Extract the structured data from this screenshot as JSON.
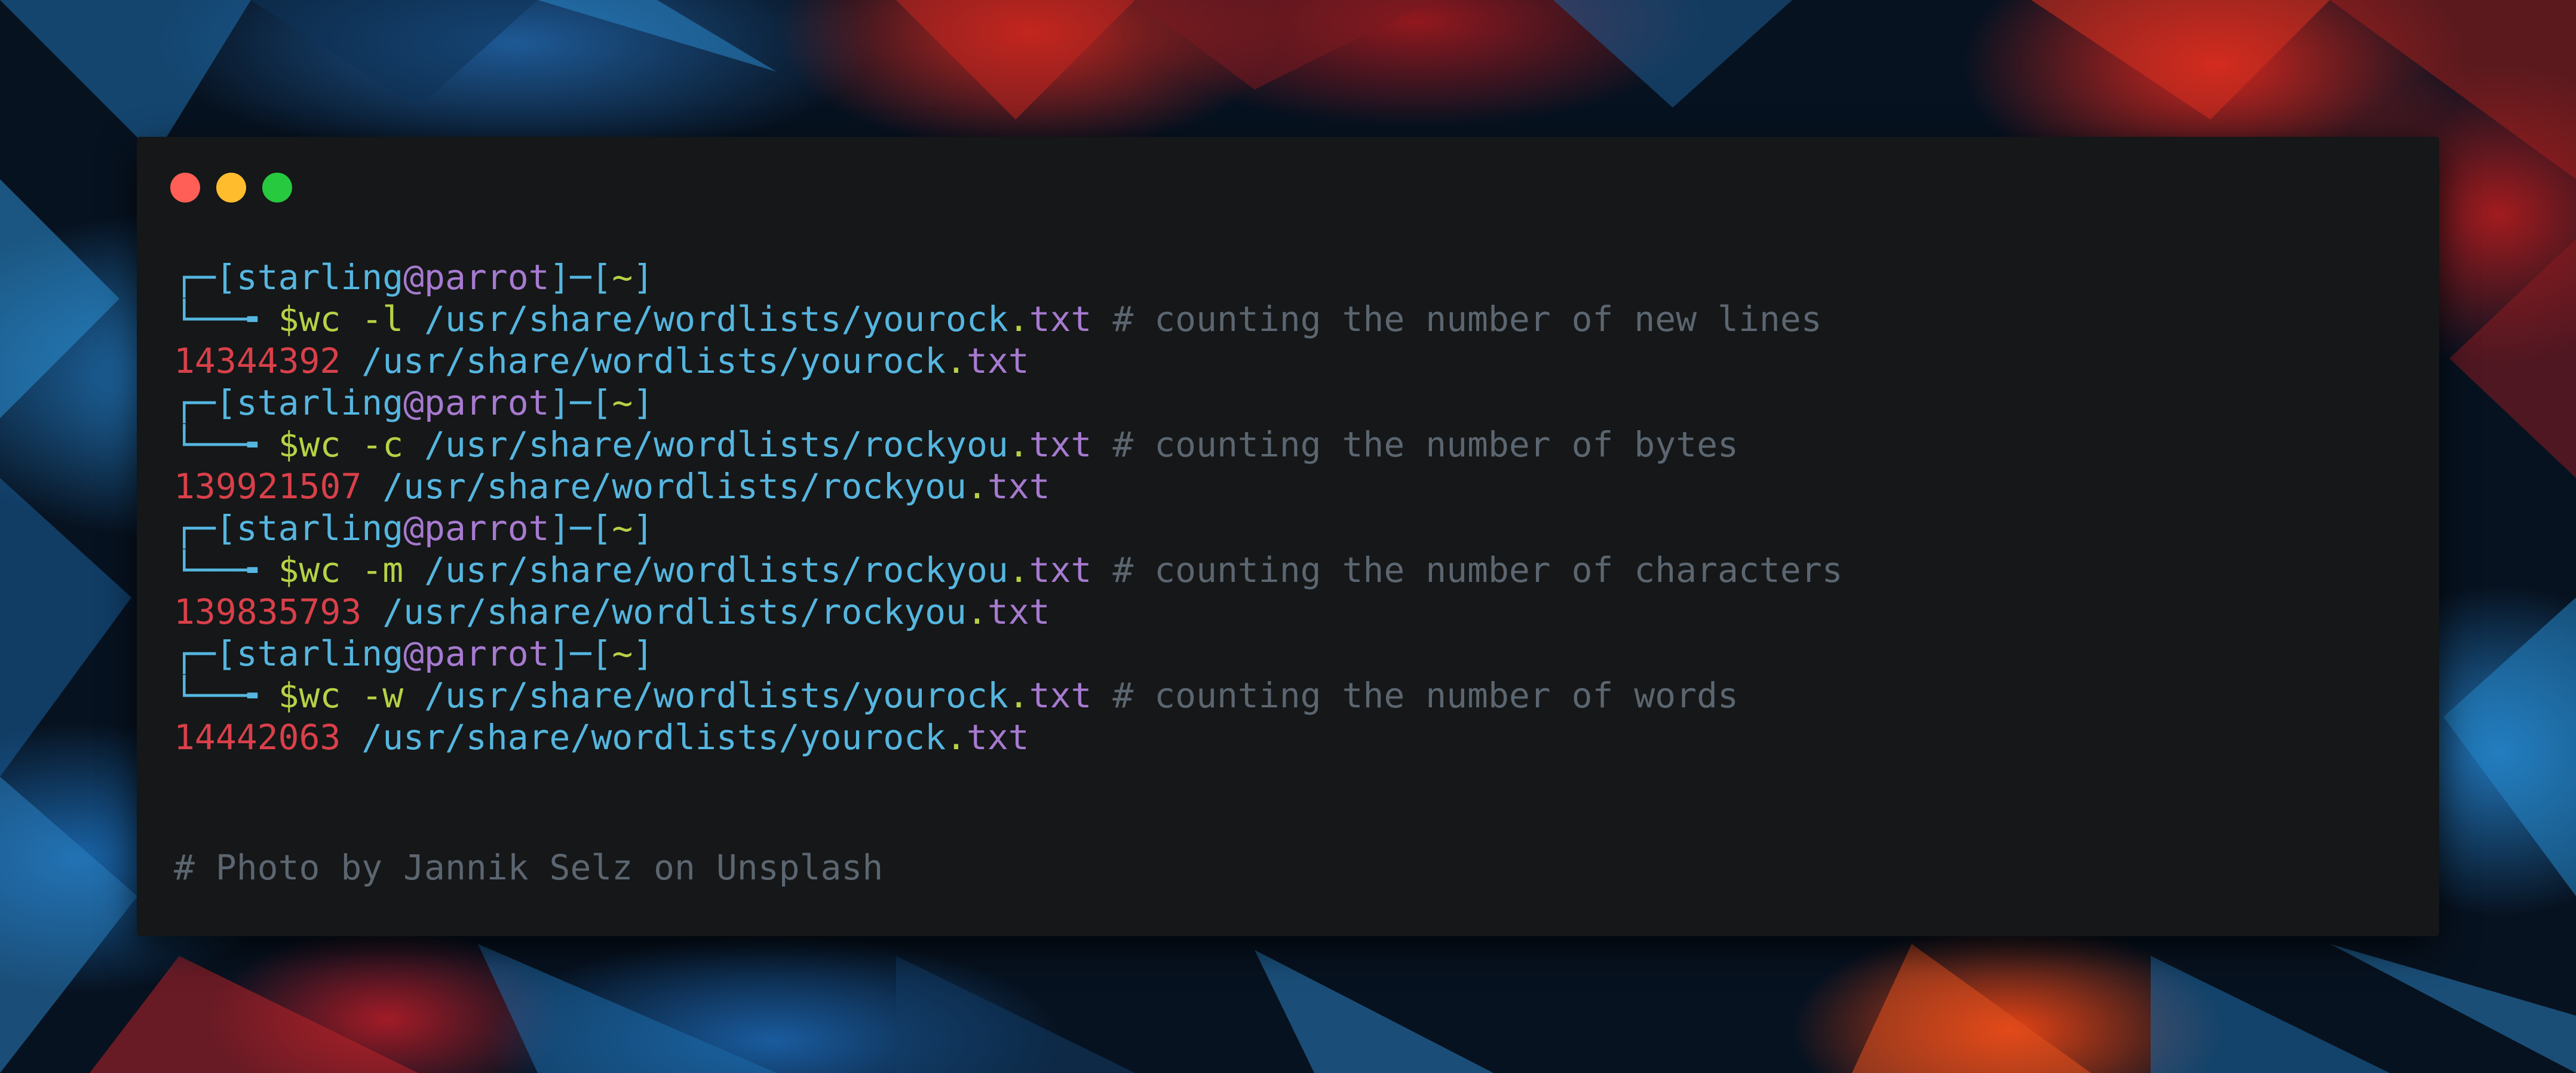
{
  "window": {
    "controls": [
      {
        "name": "close",
        "color": "#ff5f56"
      },
      {
        "name": "minimize",
        "color": "#ffbd2e"
      },
      {
        "name": "maximize",
        "color": "#27c93f"
      }
    ]
  },
  "prompt": {
    "top_left": "┌─[",
    "user": "starling",
    "at": "@",
    "host": "parrot",
    "mid": "]─[",
    "dir": "~",
    "close": "]",
    "arrow": "└──╼ ",
    "symbol": "$"
  },
  "commands": [
    {
      "cmd": "wc",
      "flag": "-l",
      "path_base": "/usr/share/wordlists/yourock",
      "dot": ".",
      "ext": "txt",
      "comment": "# counting the number of new lines",
      "output_count": "14344392",
      "output_path_base": "/usr/share/wordlists/yourock",
      "output_dot": ".",
      "output_ext": "txt"
    },
    {
      "cmd": "wc",
      "flag": "-c",
      "path_base": "/usr/share/wordlists/rockyou",
      "dot": ".",
      "ext": "txt",
      "comment": "# counting the number of bytes",
      "output_count": "139921507",
      "output_path_base": "/usr/share/wordlists/rockyou",
      "output_dot": ".",
      "output_ext": "txt"
    },
    {
      "cmd": "wc",
      "flag": "-m",
      "path_base": "/usr/share/wordlists/rockyou",
      "dot": ".",
      "ext": "txt",
      "comment": "# counting the number of characters",
      "output_count": "139835793",
      "output_path_base": "/usr/share/wordlists/rockyou",
      "output_dot": ".",
      "output_ext": "txt"
    },
    {
      "cmd": "wc",
      "flag": "-w",
      "path_base": "/usr/share/wordlists/yourock",
      "dot": ".",
      "ext": "txt",
      "comment": "# counting the number of words",
      "output_count": "14442063",
      "output_path_base": "/usr/share/wordlists/yourock",
      "output_dot": ".",
      "output_ext": "txt"
    }
  ],
  "credit": "# Photo by Jannik Selz on Unsplash"
}
